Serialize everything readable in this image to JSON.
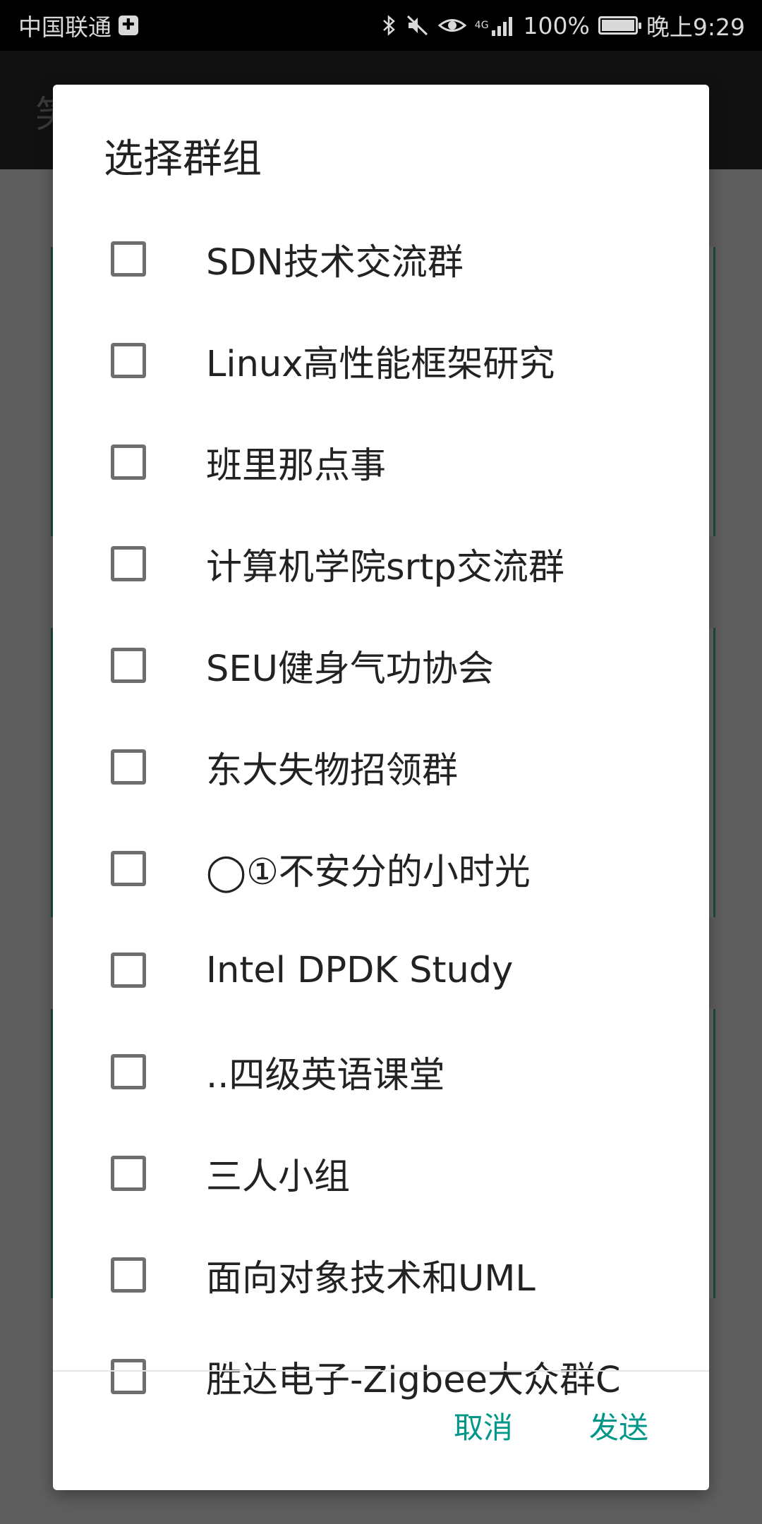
{
  "status_bar": {
    "carrier": "中国联通",
    "network": "4G",
    "battery": "100%",
    "time": "晚上9:29"
  },
  "background_app": {
    "title_partial": "笑"
  },
  "dialog": {
    "title": "选择群组",
    "items": [
      {
        "label": "SDN技术交流群",
        "checked": false
      },
      {
        "label": "Linux高性能框架研究",
        "checked": false
      },
      {
        "label": "班里那点事",
        "checked": false
      },
      {
        "label": "计算机学院srtp交流群",
        "checked": false
      },
      {
        "label": "SEU健身气功协会",
        "checked": false
      },
      {
        "label": "东大失物招领群",
        "checked": false
      },
      {
        "label": "◯①不安分的小时光",
        "checked": false
      },
      {
        "label": "Intel DPDK Study",
        "checked": false
      },
      {
        "label": "..四级英语课堂",
        "checked": false
      },
      {
        "label": "三人小组",
        "checked": false
      },
      {
        "label": "面向对象技术和UML",
        "checked": false
      },
      {
        "label": "胜达电子-Zigbee大众群C",
        "checked": false
      }
    ],
    "cancel_label": "取消",
    "send_label": "发送"
  },
  "colors": {
    "accent": "#009688",
    "scrim": "#5f5f5f"
  }
}
